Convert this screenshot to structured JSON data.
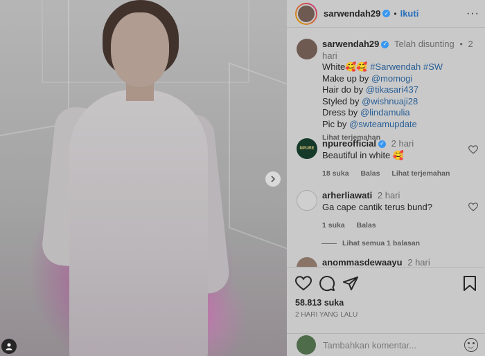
{
  "post": {
    "author": "sarwendah29",
    "follow_label": "Ikuti",
    "more_icon": "more-horizontal-icon"
  },
  "caption": {
    "username": "sarwendah29",
    "edited": "Telah disunting",
    "time": "2 hari",
    "line1_text": "White",
    "line1_emoji": "🥰🥰",
    "line1_tags": "#Sarwendah #SW",
    "credits": [
      {
        "prefix": "Make up by ",
        "handle": "@momogi"
      },
      {
        "prefix": "Hair do by ",
        "handle": "@tikasari437"
      },
      {
        "prefix": "Styled by ",
        "handle": "@wishnuaji28"
      },
      {
        "prefix": "Dress by ",
        "handle": "@lindamulia"
      },
      {
        "prefix": "Pic by ",
        "handle": "@swteamupdate"
      }
    ],
    "translate": "Lihat terjemahan"
  },
  "comments": [
    {
      "username": "npureofficial",
      "time": "2 hari",
      "text": "Beautiful in white",
      "emoji": "🥰",
      "likes": "18 suka",
      "reply": "Balas",
      "translate": "Lihat terjemahan",
      "avatar_text": "NPURE"
    },
    {
      "username": "arherliawati",
      "time": "2 hari",
      "text": "Ga cape cantik terus bund?",
      "likes": "1 suka",
      "reply": "Balas",
      "view_replies": "Lihat semua 1 balasan"
    },
    {
      "username": "anommasdewaayu",
      "time": "2 hari"
    }
  ],
  "stats": {
    "likes": "58.813 suka",
    "posted": "2 hari yang lalu"
  },
  "add_comment": {
    "placeholder": "Tambahkan komentar..."
  },
  "colors": {
    "panel_bg": "#c9c9c9",
    "link": "#2a5f96",
    "follow": "#2a6fbd",
    "verified": "#3897f0"
  }
}
